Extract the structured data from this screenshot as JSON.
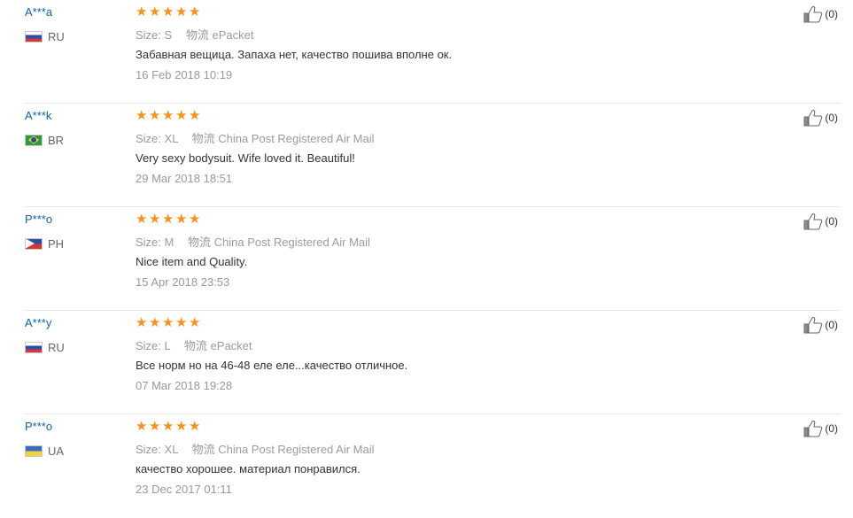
{
  "labels": {
    "size": "Size:",
    "logistics": "物流"
  },
  "reviews": [
    {
      "buyer": "A***a",
      "country": "RU",
      "flag": "ru-flag",
      "stars": 5,
      "size": "S",
      "shipping": "ePacket",
      "text": "Забавная вещица. Запаха нет, качество пошива вполне ок.",
      "date": "16 Feb 2018 10:19",
      "helpful": "(0)"
    },
    {
      "buyer": "A***k",
      "country": "BR",
      "flag": "br-flag",
      "stars": 5,
      "size": "XL",
      "shipping": "China Post Registered Air Mail",
      "text": "Very sexy bodysuit. Wife loved it. Beautiful!",
      "date": "29 Mar 2018 18:51",
      "helpful": "(0)"
    },
    {
      "buyer": "P***o",
      "country": "PH",
      "flag": "ph-flag",
      "stars": 5,
      "size": "M",
      "shipping": "China Post Registered Air Mail",
      "text": "Nice item and Quality.",
      "date": "15 Apr 2018 23:53",
      "helpful": "(0)"
    },
    {
      "buyer": "A***y",
      "country": "RU",
      "flag": "ru-flag",
      "stars": 5,
      "size": "L",
      "shipping": "ePacket",
      "text": "Все норм но на 46-48 еле еле...качество отличное.",
      "date": "07 Mar 2018 19:28",
      "helpful": "(0)"
    },
    {
      "buyer": "P***o",
      "country": "UA",
      "flag": "ua-flag",
      "stars": 5,
      "size": "XL",
      "shipping": "China Post Registered Air Mail",
      "text": "качество хорошее. материал понравился.",
      "date": "23 Dec 2017 01:11",
      "helpful": "(0)"
    }
  ],
  "colors": {
    "buyer_name": "#0f62b0",
    "star": "#f7921c",
    "muted_text": "#999999",
    "divider": "#e8e8e8"
  },
  "icons": {
    "star": "star-icon",
    "helpful": "thumbs-up-icon"
  }
}
